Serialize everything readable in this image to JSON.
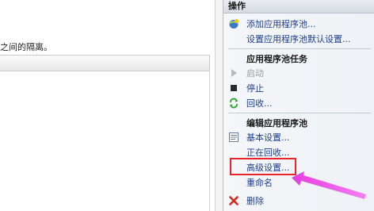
{
  "left_pane": {
    "description": "之间的隔离。"
  },
  "actions": {
    "title": "操作",
    "top_items": [
      {
        "label": "添加应用程序池...",
        "icon": "add-app-pool-icon"
      },
      {
        "label": "设置应用程序池默认设置...",
        "icon": ""
      }
    ],
    "tasks_group": {
      "title": "应用程序池任务",
      "items": [
        {
          "label": "启动",
          "icon": "play-icon",
          "disabled": true
        },
        {
          "label": "停止",
          "icon": "stop-icon",
          "disabled": false
        },
        {
          "label": "回收...",
          "icon": "recycle-icon",
          "disabled": false
        }
      ]
    },
    "edit_group": {
      "title": "编辑应用程序池",
      "items": [
        {
          "label": "基本设置...",
          "icon": "basic-settings-icon"
        },
        {
          "label": "正在回收...",
          "icon": ""
        },
        {
          "label": "高级设置...",
          "icon": ""
        },
        {
          "label": "重命名",
          "icon": ""
        },
        {
          "label": "删除",
          "icon": "delete-icon"
        }
      ]
    }
  },
  "annotation": {
    "highlight_color": "#e8232b",
    "arrow_color": "#e040e8"
  }
}
